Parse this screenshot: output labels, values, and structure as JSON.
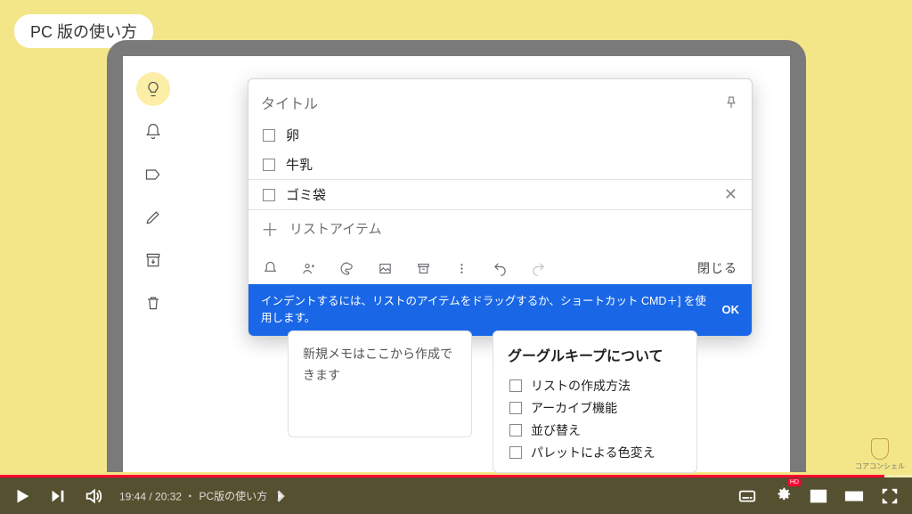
{
  "tag": "PC 版の使い方",
  "sidebar": {
    "items": [
      {
        "name": "bulb-icon",
        "active": true
      },
      {
        "name": "bell-icon",
        "active": false
      },
      {
        "name": "tag-icon",
        "active": false
      },
      {
        "name": "pencil-icon",
        "active": false
      },
      {
        "name": "archive-icon",
        "active": false
      },
      {
        "name": "trash-icon",
        "active": false
      }
    ]
  },
  "note": {
    "title_placeholder": "タイトル",
    "items": [
      {
        "text": "卵",
        "focused": false
      },
      {
        "text": "牛乳",
        "focused": false
      },
      {
        "text": "ゴミ袋",
        "focused": true
      }
    ],
    "add_item": "リストアイテム",
    "close": "閉じる"
  },
  "hint": {
    "text": "インデントするには、リストのアイテムをドラッグするか、ショートカット CMD＋] を使用します。",
    "ok": "OK"
  },
  "card1": {
    "text": "新規メモはここから作成できます"
  },
  "card2": {
    "title": "グーグルキープについて",
    "items": [
      "リストの作成方法",
      "アーカイブ機能",
      "並び替え",
      "パレットによる色変え"
    ]
  },
  "watermark": "コアコンシェル",
  "player": {
    "current": "19:44",
    "total": "20:32",
    "chapter": "PC版の使い方",
    "hd": "HD"
  }
}
